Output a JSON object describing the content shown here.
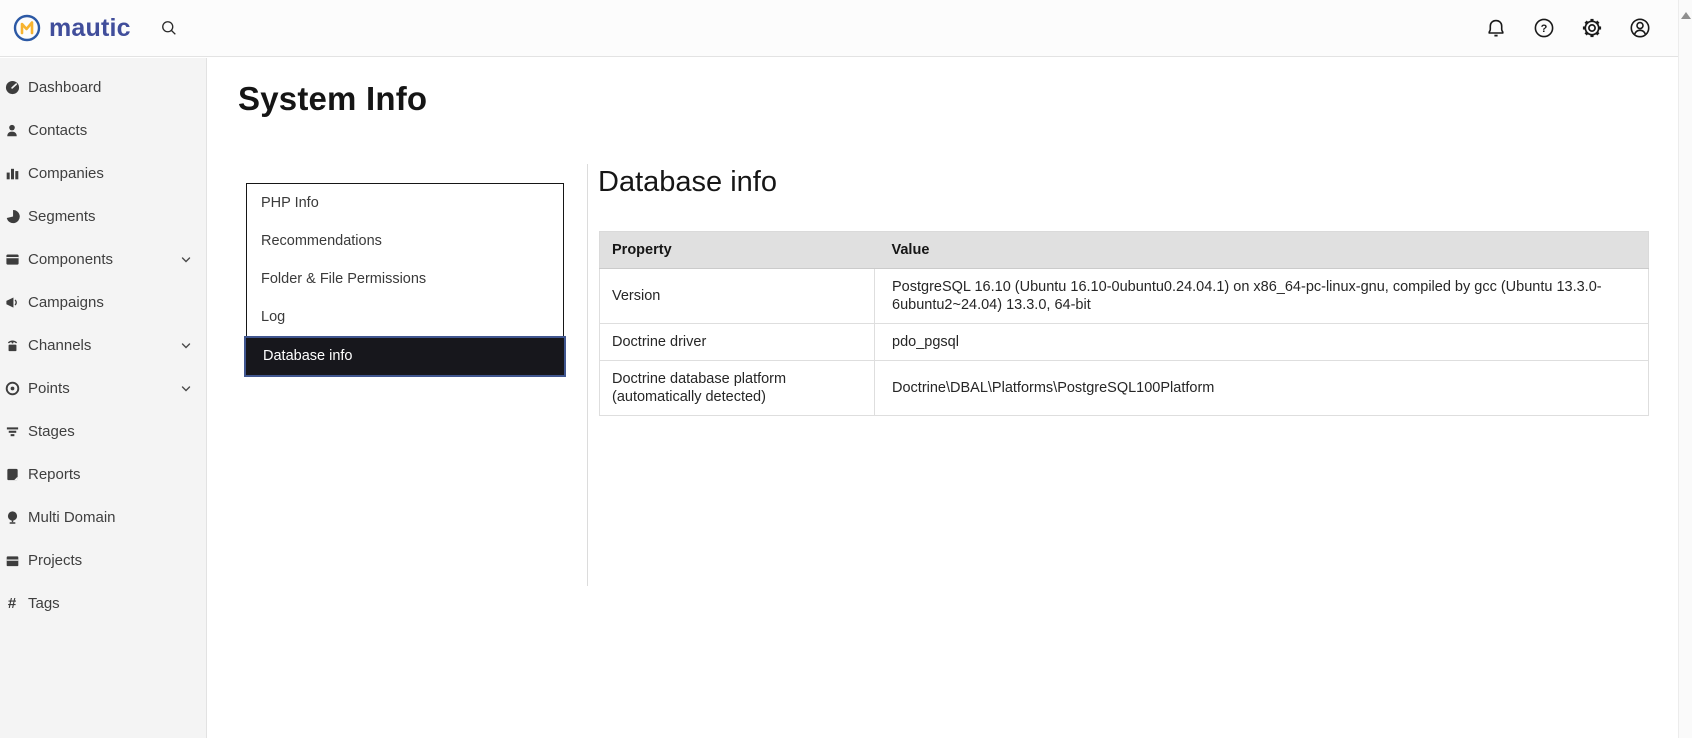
{
  "brand": {
    "name": "mautic"
  },
  "colors": {
    "brand_circle_blue": "#2c59a5",
    "brand_m_yellow": "#f7b32f",
    "wordmark_blue": "#414e9b",
    "sidebar_bg": "#f4f4f4",
    "selected_tab_bg": "#17171c",
    "selected_tab_border": "#40568f",
    "table_header_bg": "#e0e0e0"
  },
  "topbar": {
    "search_icon": "search-icon",
    "right_icons": [
      {
        "name": "notifications-bell-icon"
      },
      {
        "name": "help-icon"
      },
      {
        "name": "settings-gear-icon"
      },
      {
        "name": "user-account-icon"
      }
    ]
  },
  "scrollbar": {
    "up_arrow": "scroll-up-arrow"
  },
  "sidebar": {
    "items": [
      {
        "label": "Dashboard",
        "icon": "dashboard-gauge-icon",
        "has_submenu": false
      },
      {
        "label": "Contacts",
        "icon": "contacts-person-icon",
        "has_submenu": false
      },
      {
        "label": "Companies",
        "icon": "companies-bars-icon",
        "has_submenu": false
      },
      {
        "label": "Segments",
        "icon": "segments-pie-icon",
        "has_submenu": false
      },
      {
        "label": "Components",
        "icon": "components-box-icon",
        "has_submenu": true
      },
      {
        "label": "Campaigns",
        "icon": "campaigns-megaphone-icon",
        "has_submenu": false
      },
      {
        "label": "Channels",
        "icon": "channels-broadcast-icon",
        "has_submenu": true
      },
      {
        "label": "Points",
        "icon": "points-target-icon",
        "has_submenu": true
      },
      {
        "label": "Stages",
        "icon": "stages-funnel-icon",
        "has_submenu": false
      },
      {
        "label": "Reports",
        "icon": "reports-document-icon",
        "has_submenu": false
      },
      {
        "label": "Multi Domain",
        "icon": "multi-domain-globe-icon",
        "has_submenu": false
      },
      {
        "label": "Projects",
        "icon": "projects-box-icon",
        "has_submenu": false
      },
      {
        "label": "Tags",
        "icon": "tags-hash-icon",
        "has_submenu": false
      }
    ]
  },
  "page": {
    "title": "System Info"
  },
  "tabs": {
    "items": [
      {
        "label": "PHP Info",
        "selected": false
      },
      {
        "label": "Recommendations",
        "selected": false
      },
      {
        "label": "Folder & File Permissions",
        "selected": false
      },
      {
        "label": "Log",
        "selected": false
      },
      {
        "label": "Database info",
        "selected": true
      }
    ]
  },
  "panel": {
    "heading": "Database info",
    "table": {
      "headers": [
        "Property",
        "Value"
      ],
      "rows": [
        {
          "property": "Version",
          "value": "PostgreSQL 16.10 (Ubuntu 16.10-0ubuntu0.24.04.1) on x86_64-pc-linux-gnu, compiled by gcc (Ubuntu 13.3.0-6ubuntu2~24.04) 13.3.0, 64-bit"
        },
        {
          "property": "Doctrine driver",
          "value": "pdo_pgsql"
        },
        {
          "property": "Doctrine database platform (automatically detected)",
          "value": "Doctrine\\DBAL\\Platforms\\PostgreSQL100Platform"
        }
      ]
    }
  }
}
